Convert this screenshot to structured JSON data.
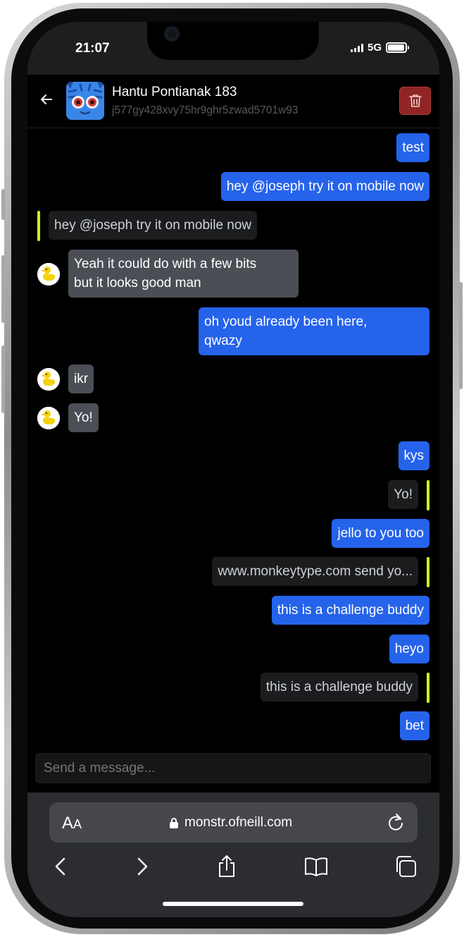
{
  "status_bar": {
    "time": "21:07",
    "network": "5G"
  },
  "chat_header": {
    "contact_name": "Hantu Pontianak 183",
    "contact_key": "j577gy428xvy75hr9ghr5zwad5701w93"
  },
  "messages": [
    {
      "type": "sent",
      "text": "test"
    },
    {
      "type": "sent",
      "text": "hey @joseph try it on mobile now"
    },
    {
      "type": "quote-left",
      "text": "hey @joseph try it on mobile now"
    },
    {
      "type": "received",
      "lines": [
        "Yeah it could do with a few bits",
        "but it looks good man"
      ]
    },
    {
      "type": "sent",
      "lines": [
        "oh youd already been here,",
        "qwazy"
      ]
    },
    {
      "type": "received",
      "text": "ikr"
    },
    {
      "type": "received",
      "text": "Yo!"
    },
    {
      "type": "sent",
      "text": "kys"
    },
    {
      "type": "quote-right",
      "text": "Yo!"
    },
    {
      "type": "sent",
      "text": "jello to you too"
    },
    {
      "type": "quote-right",
      "text": "www.monkeytype.com send yo..."
    },
    {
      "type": "sent",
      "text": "this is a challenge buddy"
    },
    {
      "type": "sent",
      "text": "heyo"
    },
    {
      "type": "quote-right",
      "text": "this is a challenge buddy"
    },
    {
      "type": "sent",
      "text": "bet"
    }
  ],
  "composer": {
    "placeholder": "Send a message..."
  },
  "browser": {
    "text_size_label": "A",
    "text_size_label_small": "A",
    "url": "monstr.ofneill.com"
  },
  "icons": {
    "back": "arrow-left-icon",
    "delete": "trash-icon",
    "lock": "lock-icon",
    "reload": "reload-icon",
    "nav_back": "chevron-left-icon",
    "nav_forward": "chevron-right-icon",
    "share": "share-icon",
    "bookmarks": "book-icon",
    "tabs": "tabs-icon"
  },
  "colors": {
    "sent_bubble": "#2563eb",
    "received_bubble": "#4b4e55",
    "quote_bar": "#d4ee19",
    "delete_button": "#8f2525"
  }
}
